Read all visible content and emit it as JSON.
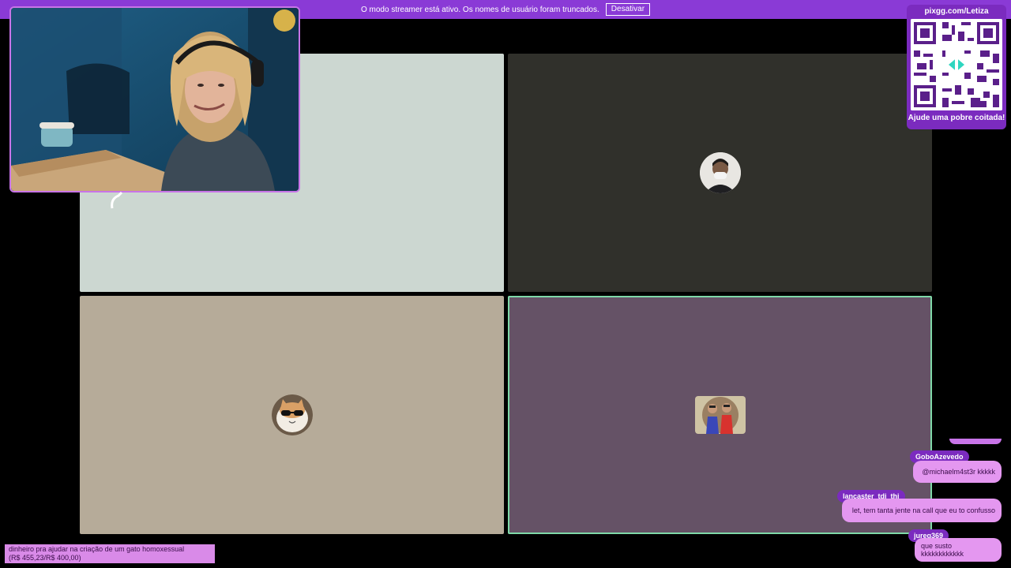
{
  "banner": {
    "text": "O modo streamer está ativo. Os nomes de usuário foram truncados.",
    "button_label": "Desativar",
    "color": "#8a3ad6"
  },
  "tiles": [
    {
      "name": "participant-tile-1",
      "bg": "#ccd7d1",
      "avatar": "none"
    },
    {
      "name": "participant-tile-2",
      "bg": "#30302b",
      "avatar": "masked-person-avatar"
    },
    {
      "name": "participant-tile-3",
      "bg": "#b6ab99",
      "avatar": "cat-sunglasses-avatar"
    },
    {
      "name": "participant-tile-4",
      "bg": "#655266",
      "avatar": "two-people-avatar",
      "selected": true
    }
  ],
  "qr": {
    "url": "pixgg.com/Letiza",
    "caption": "Ajude uma pobre coitada!"
  },
  "goal": {
    "line1": "dinheiro pra ajudar na criação de um gato homoxessual",
    "line2": "(R$ 455,23/R$ 400,00)",
    "progress_fraction": 1.0
  },
  "chat": [
    {
      "user": "GoboAzevedo",
      "message": "@michaelm4st3r kkkkk"
    },
    {
      "user": "lancaster_tdi_thi",
      "message": "let, tem tanta jente na call que eu to confusso"
    },
    {
      "user": "jureg369",
      "message": "que susto kkkkkkkkkkkk"
    }
  ]
}
